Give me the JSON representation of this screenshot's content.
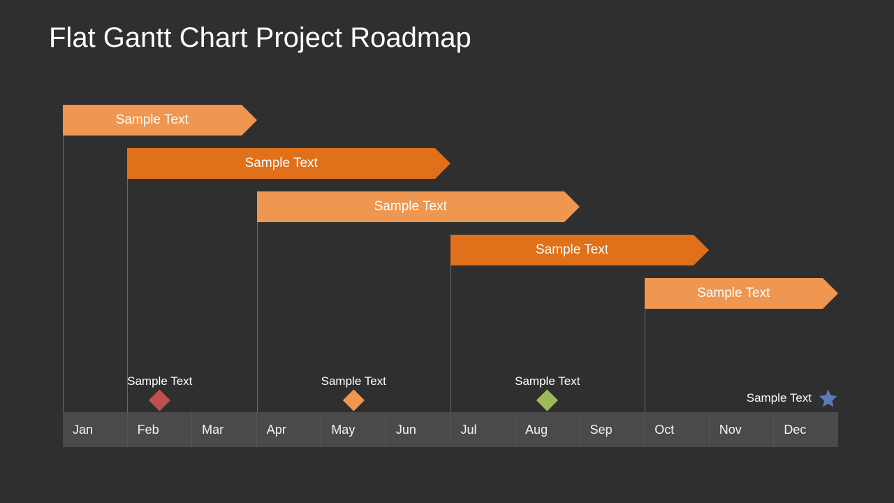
{
  "title": "Flat Gantt Chart Project Roadmap",
  "colors": {
    "background": "#2f2f2f",
    "bar_light": "#ef9650",
    "bar_dark": "#e1701a",
    "axis_bg": "#4a4a4a",
    "diamond_red": "#c0504d",
    "diamond_orange": "#ef9650",
    "diamond_green": "#9bbb59",
    "star": "#5b7bb4"
  },
  "chart_data": {
    "type": "bar",
    "title": "Flat Gantt Chart Project Roadmap",
    "categories": [
      "Jan",
      "Feb",
      "Mar",
      "Apr",
      "May",
      "Jun",
      "Jul",
      "Aug",
      "Sep",
      "Oct",
      "Nov",
      "Dec"
    ],
    "series": [
      {
        "name": "Sample Text",
        "start": 1,
        "end": 3,
        "color": "light"
      },
      {
        "name": "Sample Text",
        "start": 2,
        "end": 6,
        "color": "dark"
      },
      {
        "name": "Sample Text",
        "start": 4,
        "end": 8,
        "color": "light"
      },
      {
        "name": "Sample Text",
        "start": 7,
        "end": 10,
        "color": "dark"
      },
      {
        "name": "Sample Text",
        "start": 10,
        "end": 13,
        "color": "light"
      }
    ],
    "milestones": [
      {
        "label": "Sample Text",
        "at": 2.5,
        "shape": "diamond",
        "color": "red"
      },
      {
        "label": "Sample Text",
        "at": 5.5,
        "shape": "diamond",
        "color": "orange"
      },
      {
        "label": "Sample Text",
        "at": 8.5,
        "shape": "diamond",
        "color": "green"
      },
      {
        "label": "Sample Text",
        "at": 13,
        "shape": "star",
        "color": "star"
      }
    ],
    "xlabel": "",
    "ylabel": "",
    "xlim": [
      1,
      13
    ]
  }
}
